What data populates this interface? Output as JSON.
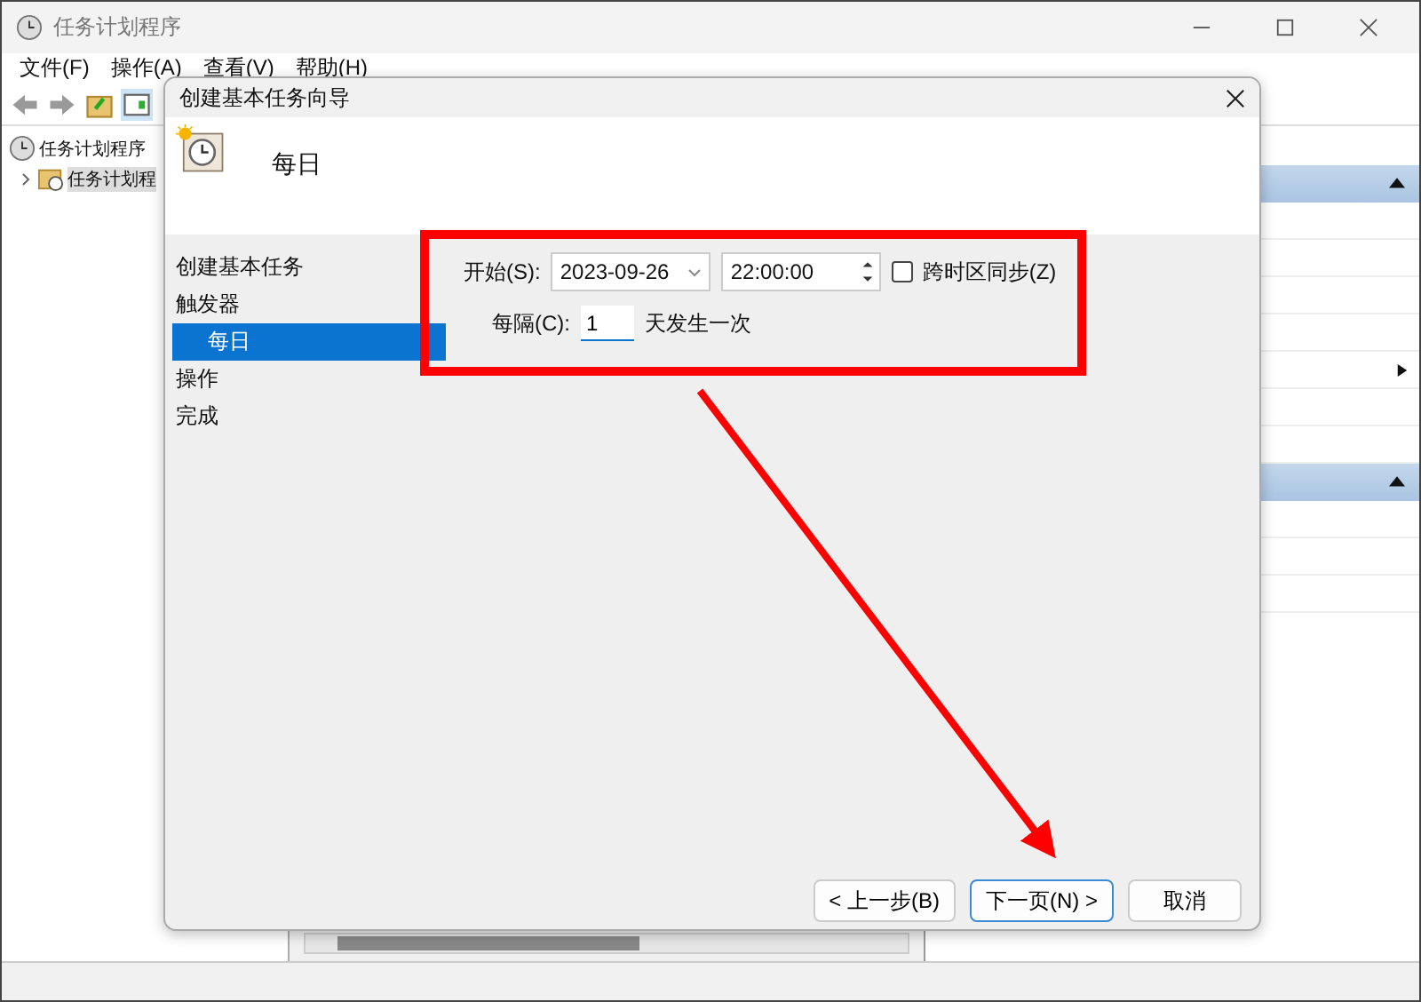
{
  "window": {
    "title": "任务计划程序"
  },
  "menu": [
    {
      "label": "文件(F)"
    },
    {
      "label": "操作(A)"
    },
    {
      "label": "查看(V)"
    },
    {
      "label": "帮助(H)"
    }
  ],
  "tree": [
    {
      "label": "任务计划程序",
      "children": [
        {
          "label": "任务计划程",
          "expanded": false
        }
      ]
    }
  ],
  "dialog": {
    "title": "创建基本任务向导",
    "heading": "每日",
    "steps": [
      {
        "label": "创建基本任务",
        "selected": false
      },
      {
        "label": "触发器",
        "selected": false,
        "children": [
          {
            "label": "每日",
            "selected": true
          }
        ]
      },
      {
        "label": "操作",
        "selected": false
      },
      {
        "label": "完成",
        "selected": false
      }
    ],
    "start_label": "开始(S):",
    "start_date": "2023-09-26",
    "start_time": "22:00:00",
    "sync": {
      "label": "跨时区同步(Z)",
      "checked": false
    },
    "recur_label": "每隔(C):",
    "recur_value": "1",
    "recur_suffix": "天发生一次",
    "buttons": [
      {
        "label": "< 上一步(B)",
        "default": false
      },
      {
        "label": "下一页(N) >",
        "default": true
      },
      {
        "label": "取消",
        "default": false
      }
    ]
  }
}
